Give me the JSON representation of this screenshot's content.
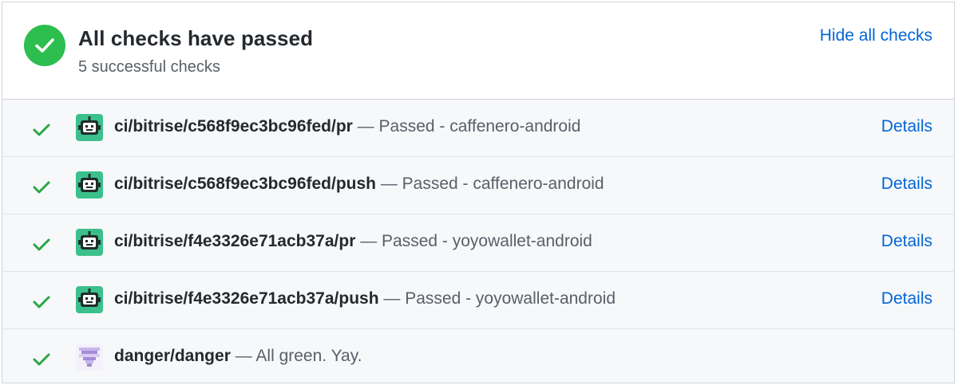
{
  "summary": {
    "title": "All checks have passed",
    "subtitle": "5 successful checks",
    "toggle_label": "Hide all checks",
    "status_color": "#2cbe4e"
  },
  "colors": {
    "link": "#0366d6",
    "success": "#28a745",
    "bitrise_avatar": "#3bc08c",
    "danger_avatar": "#a58bd6"
  },
  "checks": [
    {
      "context": "ci/bitrise/c568f9ec3bc96fed/pr",
      "description": "Passed - caffenero-android",
      "details_label": "Details",
      "avatar_icon": "bitrise-robot-icon"
    },
    {
      "context": "ci/bitrise/c568f9ec3bc96fed/push",
      "description": "Passed - caffenero-android",
      "details_label": "Details",
      "avatar_icon": "bitrise-robot-icon"
    },
    {
      "context": "ci/bitrise/f4e3326e71acb37a/pr",
      "description": "Passed - yoyowallet-android",
      "details_label": "Details",
      "avatar_icon": "bitrise-robot-icon"
    },
    {
      "context": "ci/bitrise/f4e3326e71acb37a/push",
      "description": "Passed - yoyowallet-android",
      "details_label": "Details",
      "avatar_icon": "bitrise-robot-icon"
    },
    {
      "context": "danger/danger",
      "description": "All green. Yay.",
      "avatar_icon": "danger-pixel-icon"
    }
  ]
}
